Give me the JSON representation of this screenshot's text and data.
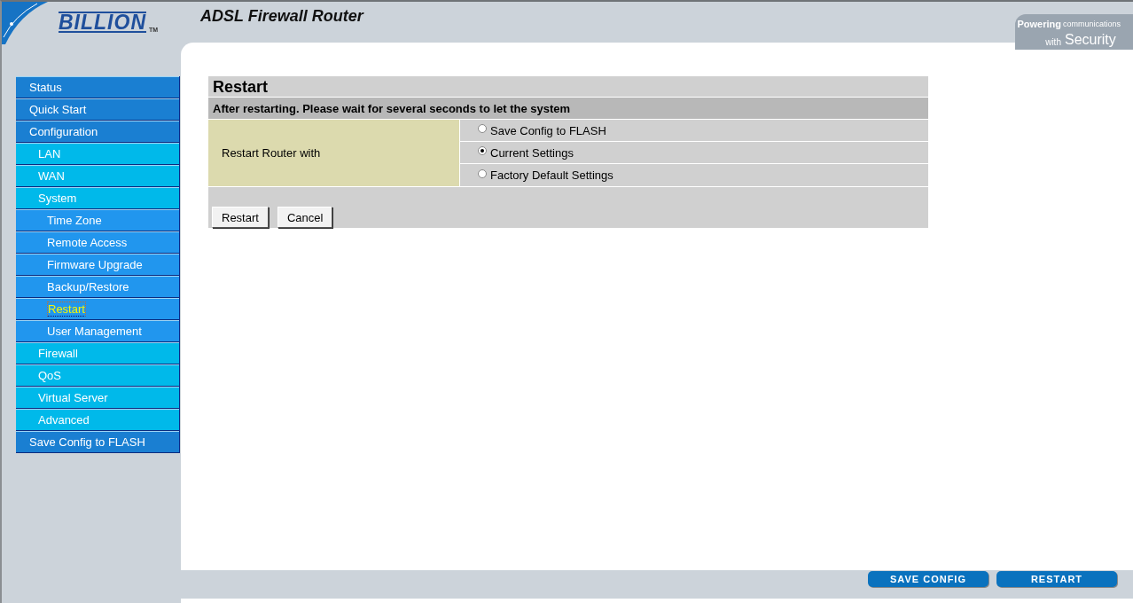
{
  "header": {
    "logo": "BILLION",
    "trademark": "TM",
    "title": "ADSL Firewall Router",
    "tagline": {
      "bold": "Powering",
      "small": "communications",
      "with": "with",
      "big": "Security"
    }
  },
  "sidebar": {
    "items": [
      {
        "label": "Status",
        "selected": false
      },
      {
        "label": "Quick Start",
        "selected": false
      },
      {
        "label": "Configuration",
        "selected": false,
        "children": [
          {
            "label": "LAN",
            "selected": false
          },
          {
            "label": "WAN",
            "selected": false
          },
          {
            "label": "System",
            "selected": false,
            "children": [
              {
                "label": "Time Zone",
                "selected": false
              },
              {
                "label": "Remote Access",
                "selected": false
              },
              {
                "label": "Firmware Upgrade",
                "selected": false
              },
              {
                "label": "Backup/Restore",
                "selected": false
              },
              {
                "label": "Restart",
                "selected": true
              },
              {
                "label": "User Management",
                "selected": false
              }
            ]
          },
          {
            "label": "Firewall",
            "selected": false
          },
          {
            "label": "QoS",
            "selected": false
          },
          {
            "label": "Virtual Server",
            "selected": false
          },
          {
            "label": "Advanced",
            "selected": false
          }
        ]
      },
      {
        "label": "Save Config to FLASH",
        "selected": false
      }
    ]
  },
  "panel": {
    "title": "Restart",
    "notice": "After restarting. Please wait for several seconds to let the system",
    "field_label": "Restart Router with",
    "options": [
      {
        "label": "Save Config to FLASH",
        "selected": false
      },
      {
        "label": "Current Settings",
        "selected": true
      },
      {
        "label": "Factory Default Settings",
        "selected": false
      }
    ],
    "buttons": [
      "Restart",
      "Cancel"
    ]
  },
  "footer_buttons": [
    "SAVE CONFIG",
    "RESTART"
  ]
}
